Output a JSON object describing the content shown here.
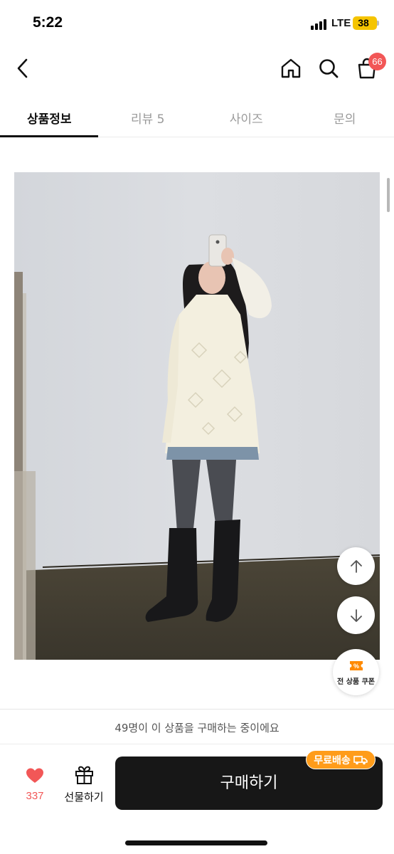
{
  "status_bar": {
    "time": "5:22",
    "network": "LTE",
    "battery": "38"
  },
  "header": {
    "back_icon": "chevron-left-icon",
    "home_icon": "home-icon",
    "search_icon": "search-icon",
    "cart_icon": "shopping-bag-icon",
    "cart_count": "66"
  },
  "tabs": [
    {
      "label": "상품정보",
      "active": true
    },
    {
      "label": "리뷰 5",
      "active": false
    },
    {
      "label": "사이즈",
      "active": false
    },
    {
      "label": "문의",
      "active": false
    }
  ],
  "floating": {
    "scroll_up_icon": "arrow-up-icon",
    "scroll_down_icon": "arrow-down-icon",
    "coupon_icon": "coupon-icon",
    "coupon_label": "전 상품 쿠폰"
  },
  "bottom_bar": {
    "buyers_notice": "49명이 이 상품을 구매하는 중이에요",
    "like_icon": "heart-icon",
    "like_count": "337",
    "gift_icon": "gift-icon",
    "gift_label": "선물하기",
    "buy_label": "구매하기",
    "free_shipping_label": "무료배송",
    "free_shipping_icon": "truck-icon"
  },
  "colors": {
    "accent_red": "#f25757",
    "free_shipping_orange": "#ff9c1a",
    "buy_button": "#171717"
  }
}
